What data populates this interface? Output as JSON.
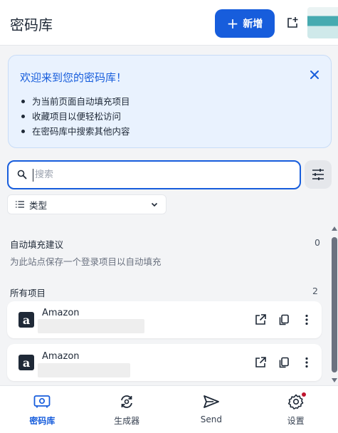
{
  "header": {
    "title": "密码库",
    "new_label": "新增"
  },
  "welcome": {
    "title": "欢迎来到您的密码库！",
    "bullets": [
      "为当前页面自动填充项目",
      "收藏项目以便轻松访问",
      "在密码库中搜索其他内容"
    ]
  },
  "search": {
    "placeholder": "搜索"
  },
  "filter": {
    "type_label": "类型"
  },
  "autofill": {
    "title": "自动填充建议",
    "count": "0",
    "hint": "为此站点保存一个登录项目以自动填充"
  },
  "all_items": {
    "title": "所有项目",
    "count": "2",
    "items": [
      {
        "name": "Amazon",
        "icon": "amazon-logo"
      },
      {
        "name": "Amazon",
        "icon": "amazon-logo"
      }
    ]
  },
  "nav": {
    "items": [
      {
        "label": "密码库",
        "icon": "vault-icon",
        "active": true
      },
      {
        "label": "生成器",
        "icon": "generator-icon"
      },
      {
        "label": "Send",
        "icon": "send-icon"
      },
      {
        "label": "设置",
        "icon": "settings-icon",
        "badge": true
      }
    ]
  },
  "colors": {
    "accent": "#175ddc",
    "badge": "#c0152f",
    "welcome_bg": "#e9f2fe"
  }
}
